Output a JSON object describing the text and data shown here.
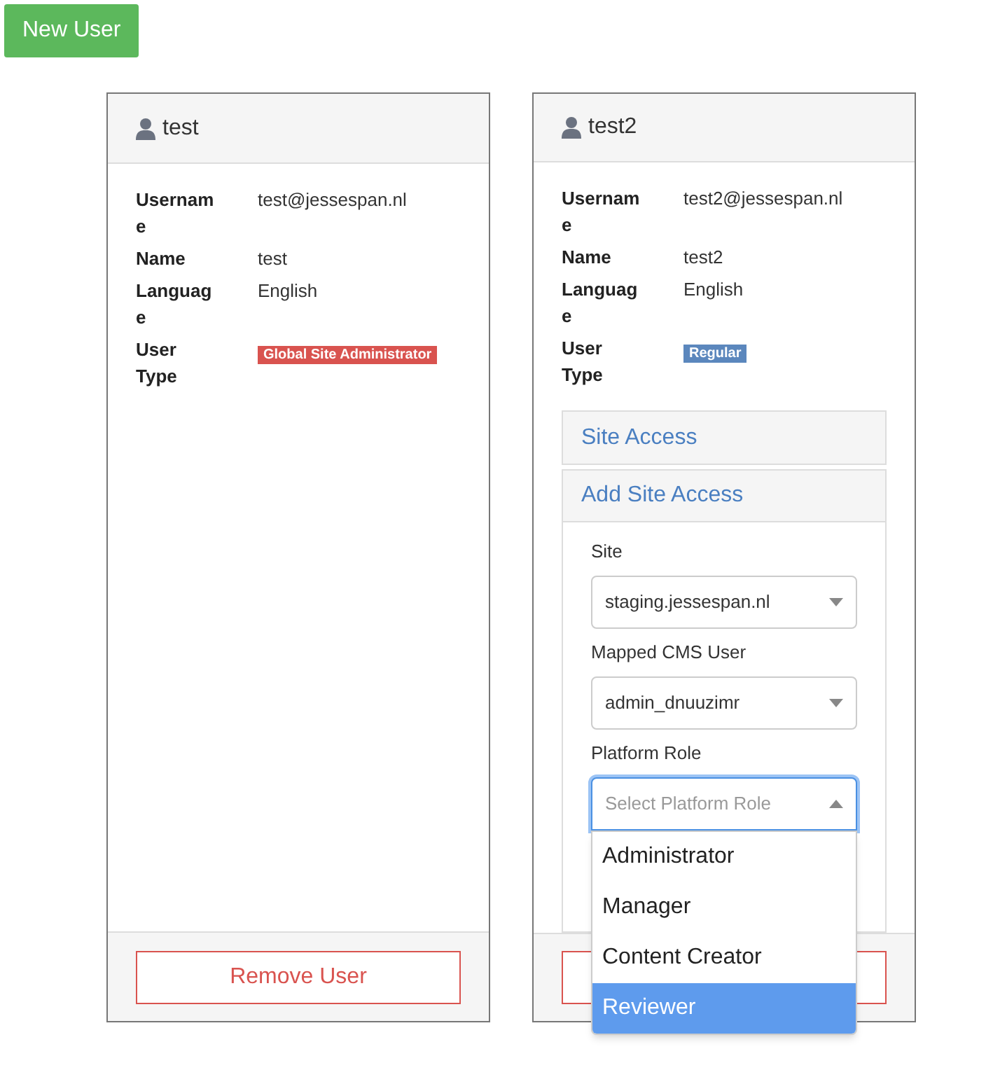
{
  "new_user_button": "New User",
  "users": [
    {
      "name": "test",
      "fields": [
        {
          "kind": "text",
          "label": "Username",
          "value": "test@jessespan.nl"
        },
        {
          "kind": "text",
          "label": "Name",
          "value": "test"
        },
        {
          "kind": "text",
          "label": "Language",
          "value": "English"
        },
        {
          "kind": "badge",
          "label": "User Type",
          "value": "Global Site Administrator",
          "color": "#d9534f"
        }
      ],
      "remove_label": "Remove User"
    },
    {
      "name": "test2",
      "fields": [
        {
          "kind": "text",
          "label": "Username",
          "value": "test2@jessespan.nl"
        },
        {
          "kind": "text",
          "label": "Name",
          "value": "test2"
        },
        {
          "kind": "text",
          "label": "Language",
          "value": "English"
        },
        {
          "kind": "badge",
          "label": "User Type",
          "value": "Regular",
          "color": "#5b87bd"
        }
      ],
      "panels": [
        {
          "title": "Site Access",
          "expanded": false
        },
        {
          "title": "Add Site Access",
          "expanded": true,
          "form": [
            {
              "label": "Site",
              "value": "staging.jessespan.nl"
            },
            {
              "label": "Mapped CMS User",
              "value": "admin_dnuuzimr"
            },
            {
              "label": "Platform Role",
              "placeholder": "Select Platform Role",
              "focused": true,
              "open": true,
              "options": [
                {
                  "label": "Administrator",
                  "selected": false
                },
                {
                  "label": "Manager",
                  "selected": false
                },
                {
                  "label": "Content Creator",
                  "selected": false
                },
                {
                  "label": "Reviewer",
                  "selected": true
                }
              ]
            }
          ]
        }
      ]
    }
  ]
}
